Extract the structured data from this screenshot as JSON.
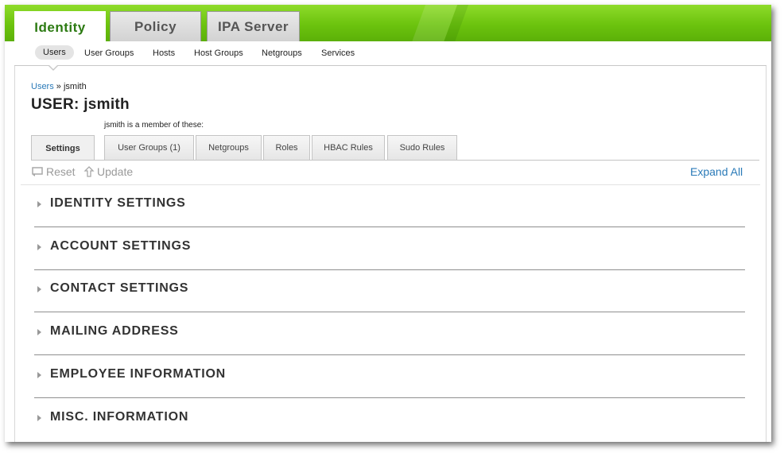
{
  "top_tabs": [
    {
      "label": "Identity",
      "active": true
    },
    {
      "label": "Policy",
      "active": false
    },
    {
      "label": "IPA Server",
      "active": false
    }
  ],
  "sub_nav": [
    {
      "label": "Users",
      "active": true
    },
    {
      "label": "User Groups",
      "active": false
    },
    {
      "label": "Hosts",
      "active": false
    },
    {
      "label": "Host Groups",
      "active": false
    },
    {
      "label": "Netgroups",
      "active": false
    },
    {
      "label": "Services",
      "active": false
    }
  ],
  "breadcrumb": {
    "parent": "Users",
    "separator": "»",
    "current": "jsmith"
  },
  "page_title": "USER: jsmith",
  "member_note": "jsmith is a member of these:",
  "facet_tabs": [
    {
      "label": "Settings",
      "active": true
    },
    {
      "label": "User Groups (1)",
      "active": false
    },
    {
      "label": "Netgroups",
      "active": false
    },
    {
      "label": "Roles",
      "active": false
    },
    {
      "label": "HBAC Rules",
      "active": false
    },
    {
      "label": "Sudo Rules",
      "active": false
    }
  ],
  "actions": {
    "reset": "Reset",
    "update": "Update",
    "expand_all": "Expand All"
  },
  "sections": [
    {
      "label": "IDENTITY SETTINGS"
    },
    {
      "label": "ACCOUNT SETTINGS"
    },
    {
      "label": "CONTACT SETTINGS"
    },
    {
      "label": "MAILING ADDRESS"
    },
    {
      "label": "EMPLOYEE INFORMATION"
    },
    {
      "label": "MISC. INFORMATION"
    }
  ],
  "colors": {
    "accent_green": "#6cc30e",
    "link_blue": "#2a7ab8",
    "active_tab_text": "#2c7a12"
  }
}
